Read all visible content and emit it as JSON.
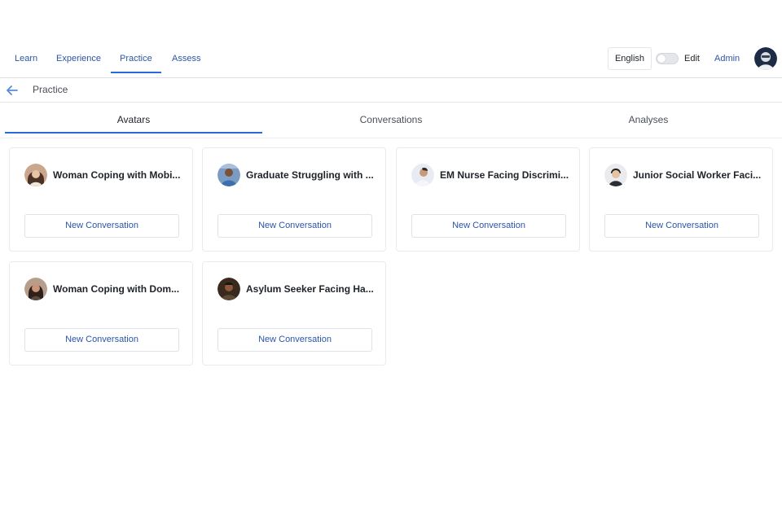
{
  "nav": {
    "items": [
      {
        "label": "Learn"
      },
      {
        "label": "Experience"
      },
      {
        "label": "Practice",
        "active": true
      },
      {
        "label": "Assess"
      }
    ],
    "language": "English",
    "edit_label": "Edit",
    "edit_toggle_on": false,
    "admin_label": "Admin"
  },
  "breadcrumb": {
    "title": "Practice"
  },
  "tabs": [
    {
      "label": "Avatars",
      "active": true
    },
    {
      "label": "Conversations"
    },
    {
      "label": "Analyses"
    }
  ],
  "cards": [
    {
      "title": "Woman Coping with Mobi...",
      "button": "New Conversation"
    },
    {
      "title": "Graduate Struggling with ...",
      "button": "New Conversation"
    },
    {
      "title": "EM Nurse Facing Discrimi...",
      "button": "New Conversation"
    },
    {
      "title": "Junior Social Worker Faci...",
      "button": "New Conversation"
    },
    {
      "title": "Woman Coping with Dom...",
      "button": "New Conversation"
    },
    {
      "title": "Asylum Seeker Facing Ha...",
      "button": "New Conversation"
    }
  ],
  "colors": {
    "accent": "#2b6bd9",
    "link": "#2b55a8",
    "border": "#e9ebee"
  },
  "icons": {
    "back": "arrow-left-icon",
    "user": "avatar"
  }
}
